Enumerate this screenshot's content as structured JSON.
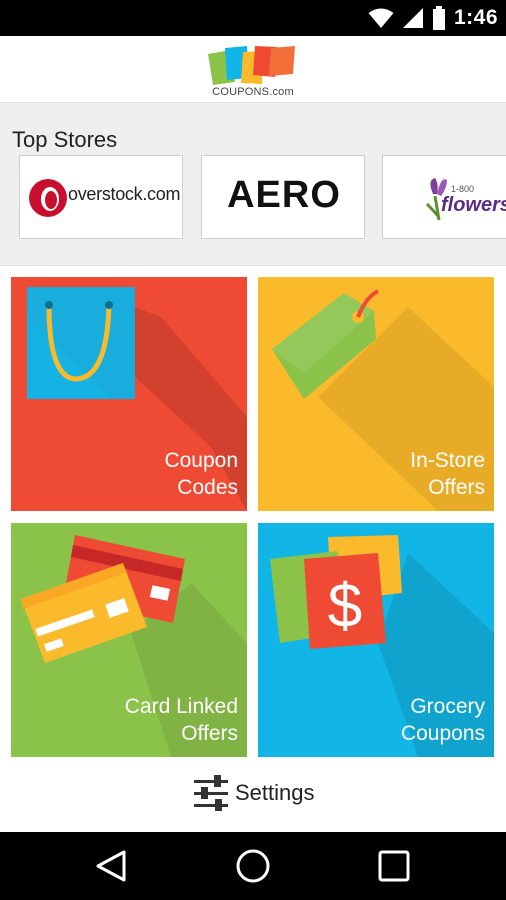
{
  "status_bar": {
    "time": "1:46",
    "icons": [
      "wifi-icon",
      "signal-icon",
      "battery-icon"
    ]
  },
  "header": {
    "logo_text": "COUPONS.com"
  },
  "top_stores": {
    "title": "Top Stores",
    "stores": [
      {
        "name": "overstock.com"
      },
      {
        "name": "AERO"
      },
      {
        "name": "flowers",
        "prefix": "1-800"
      }
    ]
  },
  "tiles": [
    {
      "line1": "Coupon",
      "line2": "Codes",
      "color": "#ee4a34"
    },
    {
      "line1": "In-Store",
      "line2": "Offers",
      "color": "#fbba2c"
    },
    {
      "line1": "Card Linked",
      "line2": "Offers",
      "color": "#8bc34a"
    },
    {
      "line1": "Grocery",
      "line2": "Coupons",
      "color": "#12b6e6"
    }
  ],
  "settings": {
    "label": "Settings"
  },
  "nav": {
    "icons": [
      "back-icon",
      "home-icon",
      "recents-icon"
    ]
  },
  "colors": {
    "logo": [
      "#8bc34a",
      "#12b6e6",
      "#fbba2c",
      "#ee4a34",
      "#f36f3a"
    ]
  }
}
